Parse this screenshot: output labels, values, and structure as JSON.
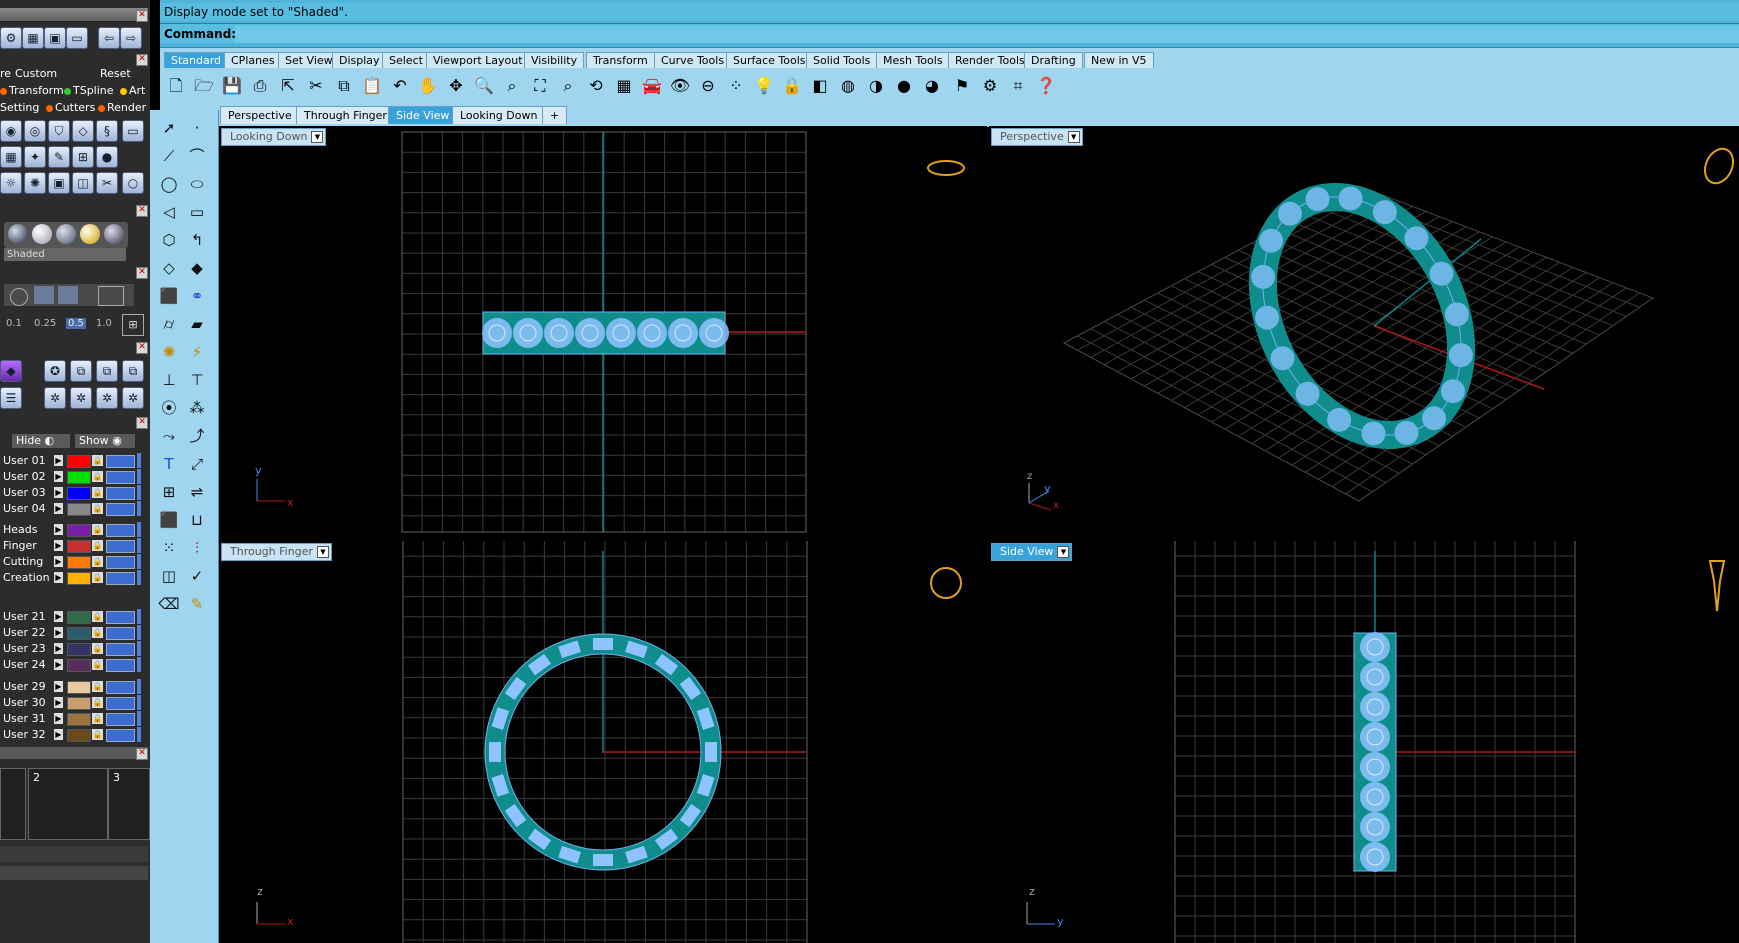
{
  "status": {
    "message": "Display mode set to \"Shaded\".",
    "command_label": "Command:",
    "command_value": ""
  },
  "toolbar_tabs": [
    "Standard",
    "CPlanes",
    "Set View",
    "Display",
    "Select",
    "Viewport Layout",
    "Visibility",
    "Transform",
    "Curve Tools",
    "Surface Tools",
    "Solid Tools",
    "Mesh Tools",
    "Render Tools",
    "Drafting",
    "New in V5"
  ],
  "viewport_tabs": [
    "Perspective",
    "Through Finger",
    "Side View",
    "Looking Down",
    "+"
  ],
  "viewports": {
    "top_left": {
      "label": "Looking Down",
      "axis1": "y",
      "axis2": "x"
    },
    "top_right": {
      "label": "Perspective",
      "axis1": "z",
      "axis2": "y",
      "axis3": "x"
    },
    "bottom_left": {
      "label": "Through Finger",
      "axis1": "z",
      "axis2": "x"
    },
    "bottom_right": {
      "label": "Side View",
      "axis1": "z",
      "axis2": "y"
    }
  },
  "left_panel": {
    "row1": {
      "a": "re",
      "b": "Custom",
      "c": "Reset"
    },
    "row2": {
      "a": "Transform",
      "b": "TSpline",
      "c": "Art"
    },
    "row3": {
      "a": "Setting",
      "b": "Cutters",
      "c": "Render"
    },
    "display_mode": "Shaded",
    "scale_values": [
      "0.1",
      "0.25",
      "0.5",
      "1.0"
    ],
    "hide_label": "Hide",
    "show_label": "Show",
    "layers": [
      {
        "name": "User 01",
        "color": "#ff0000"
      },
      {
        "name": "User 02",
        "color": "#00e000"
      },
      {
        "name": "User 03",
        "color": "#0000ff"
      },
      {
        "name": "User 04",
        "color": "#888888"
      },
      {
        "name": "Heads",
        "color": "#7a1fa8"
      },
      {
        "name": "Finger",
        "color": "#c83030"
      },
      {
        "name": "Cutting",
        "color": "#ff7a00"
      },
      {
        "name": "Creation",
        "color": "#ffb000"
      },
      {
        "name": "User 21",
        "color": "#2f6b4a"
      },
      {
        "name": "User 22",
        "color": "#2a5c6a"
      },
      {
        "name": "User 23",
        "color": "#343466"
      },
      {
        "name": "User 24",
        "color": "#5a2e5a"
      },
      {
        "name": "User 29",
        "color": "#e8c9a0"
      },
      {
        "name": "User 30",
        "color": "#c8a070"
      },
      {
        "name": "User 31",
        "color": "#9a7440"
      },
      {
        "name": "User 32",
        "color": "#6a4a18"
      }
    ],
    "bottom_labels": [
      "2",
      "3"
    ]
  },
  "colors": {
    "accent": "#39a3d9",
    "ring_teal": "#0f8c8c",
    "ring_blue": "#8ec3ff",
    "grid": "#3a3a3a",
    "xaxis": "#b01818",
    "yaxis": "#12808c"
  }
}
